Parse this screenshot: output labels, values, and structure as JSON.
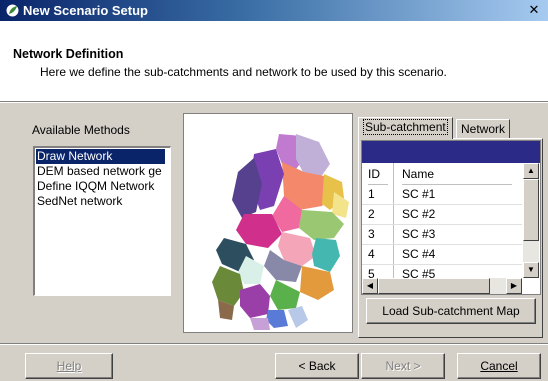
{
  "window": {
    "title": "New Scenario Setup",
    "close_glyph": "✕"
  },
  "header": {
    "title": "Network Definition",
    "subtitle": "Here we define the sub-catchments and network to be used by this scenario."
  },
  "methods": {
    "label": "Available Methods",
    "items": [
      "Draw Network",
      "DEM based network ge",
      "Define IQQM Network",
      "SedNet network"
    ],
    "selected": "Draw Network"
  },
  "tabs": [
    "Sub-catchment",
    "Network"
  ],
  "subcatchment_table": {
    "columns": [
      "ID",
      "Name"
    ],
    "rows": [
      {
        "id": "1",
        "name": "SC #1"
      },
      {
        "id": "2",
        "name": "SC #2"
      },
      {
        "id": "3",
        "name": "SC #3"
      },
      {
        "id": "4",
        "name": "SC #4"
      },
      {
        "id": "5",
        "name": "SC #5"
      }
    ]
  },
  "load_button": "Load Sub-catchment Map",
  "footer": {
    "help": "Help",
    "back": "< Back",
    "next": "Next >",
    "cancel": "Cancel"
  },
  "icons": {
    "window_icon": "leaf-icon",
    "scroll_up": "arrow-up-icon",
    "scroll_down": "arrow-down-icon",
    "scroll_left": "arrow-left-icon",
    "scroll_right": "arrow-right-icon"
  },
  "colors": {
    "title_gradient_start": "#0a246a",
    "selection": "#0a246a",
    "grid_header": "#2b2a87",
    "dialog_bg": "#d4d0c8"
  }
}
